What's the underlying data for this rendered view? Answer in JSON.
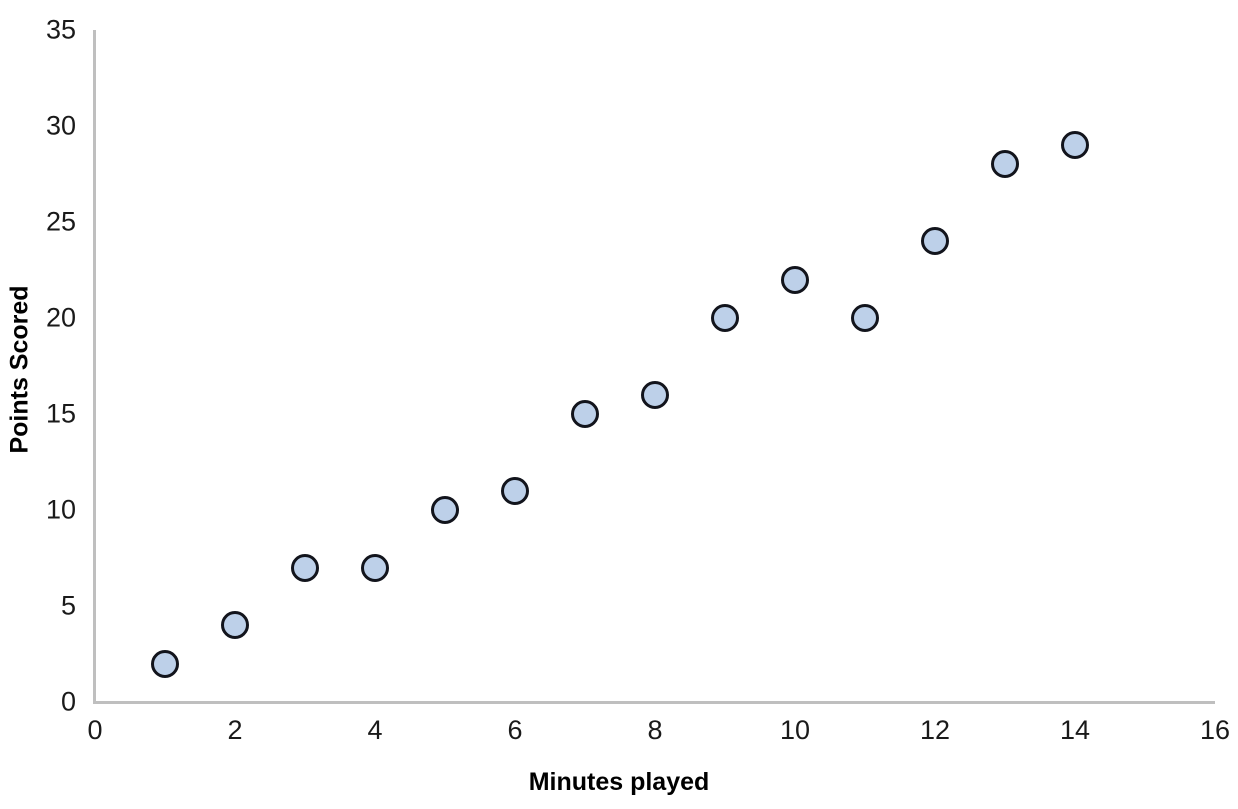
{
  "chart_data": {
    "type": "scatter",
    "title": "",
    "xlabel": "Minutes played",
    "ylabel": "Points Scored",
    "xlim": [
      0,
      16
    ],
    "ylim": [
      0,
      35
    ],
    "xticks": [
      0,
      2,
      4,
      6,
      8,
      10,
      12,
      14,
      16
    ],
    "yticks": [
      0,
      5,
      10,
      15,
      20,
      25,
      30,
      35
    ],
    "grid": false,
    "legend": false,
    "series": [
      {
        "name": "Points Scored",
        "marker": "circle",
        "marker_fill": "#bdd0e9",
        "marker_edge": "#12141c",
        "x": [
          1,
          2,
          3,
          4,
          5,
          6,
          7,
          8,
          9,
          10,
          11,
          12,
          13,
          14
        ],
        "y": [
          2,
          4,
          7,
          7,
          10,
          11,
          15,
          16,
          20,
          22,
          20,
          24,
          28,
          29
        ],
        "points": [
          {
            "x": 1,
            "y": 2
          },
          {
            "x": 2,
            "y": 4
          },
          {
            "x": 3,
            "y": 7
          },
          {
            "x": 4,
            "y": 7
          },
          {
            "x": 5,
            "y": 10
          },
          {
            "x": 6,
            "y": 11
          },
          {
            "x": 7,
            "y": 15
          },
          {
            "x": 8,
            "y": 16
          },
          {
            "x": 9,
            "y": 20
          },
          {
            "x": 10,
            "y": 22
          },
          {
            "x": 11,
            "y": 20
          },
          {
            "x": 12,
            "y": 24
          },
          {
            "x": 13,
            "y": 28
          },
          {
            "x": 14,
            "y": 29
          }
        ]
      }
    ],
    "colors": {
      "axis_line": "#bfbfbf",
      "tick_label": "#1a1a1a",
      "axis_title": "#000000",
      "background": "#ffffff"
    }
  }
}
